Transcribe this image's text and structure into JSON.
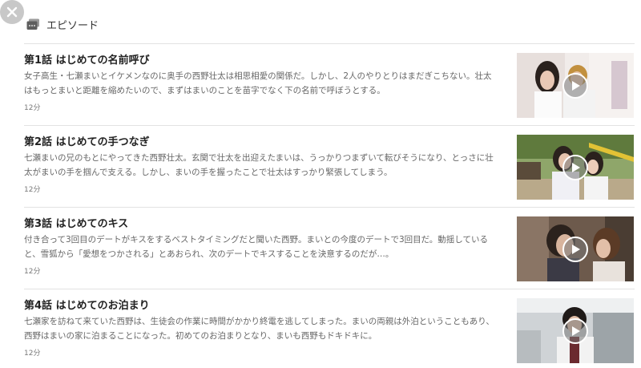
{
  "header": {
    "title": "エピソード",
    "icon": "episode-list-icon"
  },
  "close": {
    "icon": "close-icon"
  },
  "episodes": [
    {
      "title": "第1話 はじめての名前呼び",
      "description": "女子高生・七瀬まいとイケメンなのに奥手の西野壮太は相思相愛の関係だ。しかし、2人のやりとりはまだぎこちない。壮太はもっとまいと距離を縮めたいので、まずはまいのことを苗字でなく下の名前で呼ぼうとする。",
      "duration": "12分"
    },
    {
      "title": "第2話 はじめての手つなぎ",
      "description": "七瀬まいの兄のもとにやってきた西野壮太。玄関で壮太を出迎えたまいは、うっかりつまずいて転びそうになり、とっさに壮太がまいの手を掴んで支える。しかし、まいの手を握ったことで壮太はすっかり緊張してしまう。",
      "duration": "12分"
    },
    {
      "title": "第3話 はじめてのキス",
      "description": "付き合って3回目のデートがキスをするベストタイミングだと聞いた西野。まいとの今度のデートで3回目だ。動揺していると、雪狐から「愛想をつかされる」とあおられ、次のデートでキスすることを決意するのだが…。",
      "duration": "12分"
    },
    {
      "title": "第4話 はじめてのお泊まり",
      "description": "七瀬家を訪ねて来ていた西野は、生徒会の作業に時間がかかり終電を逃してしまった。まいの両親は外泊ということもあり、西野はまいの家に泊まることになった。初めてのお泊まりとなり、まいも西野もドキドキに。",
      "duration": "12分"
    }
  ]
}
